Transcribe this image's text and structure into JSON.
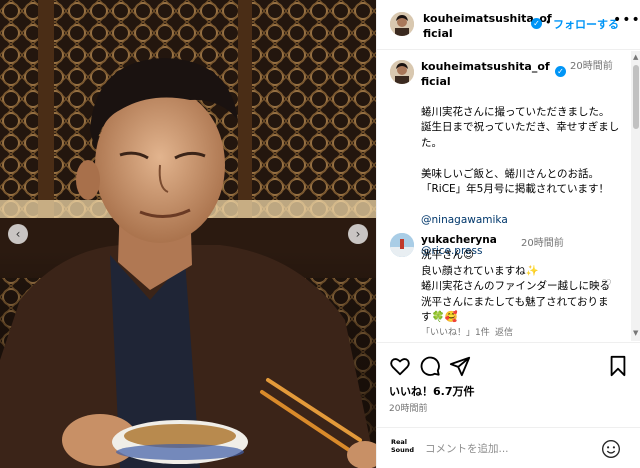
{
  "post": {
    "username": "kouheimatsushita_official",
    "follow_label": "フォローする",
    "separator": "•",
    "more_label": "•••"
  },
  "caption": {
    "username": "kouheimatsushita_official",
    "time": "20時間前",
    "text": "蜷川実花さんに撮っていただきました。\n誕生日まで祝っていただき、幸せすぎました。\n\n美味しいご飯と、蜷川さんとのお話。\n「RiCE」年5月号に掲載されています！\n",
    "mentions": [
      "@ninagawamika",
      "@rice.press"
    ]
  },
  "comment": {
    "username": "yukacheryna",
    "time": "20時間前",
    "text": "洸平さん😊\n良い顔されていますね✨\n蜷川実花さんのファインダー越しに映る洸平さんにまたしても魅了されております🍀🥰",
    "likes_label": "「いいね！」1件",
    "reply_label": "返信"
  },
  "footer": {
    "likes": "いいね！6.7万件",
    "posted": "20時間前",
    "comment_placeholder": "コメントを追加...",
    "realsound_label": "Real Sound"
  },
  "colors": {
    "accent": "#0095f6",
    "mention": "#00376b",
    "muted": "#737373"
  },
  "icons": [
    "chevron-left-icon",
    "chevron-right-icon",
    "verified-icon",
    "heart-icon",
    "comment-icon",
    "share-icon",
    "bookmark-icon",
    "emoji-icon"
  ]
}
